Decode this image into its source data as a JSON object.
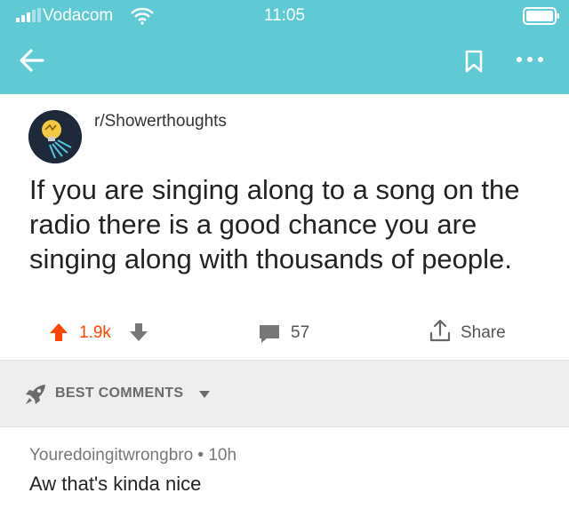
{
  "status_bar": {
    "carrier": "Vodacom",
    "time": "11:05"
  },
  "colors": {
    "header_bg": "#5fc9d4",
    "upvote_accent": "#ff4500",
    "sort_bar_bg": "#eeeeef"
  },
  "icons": {
    "back": "arrow-left-icon",
    "bookmark": "bookmark-icon",
    "more": "more-horizontal-icon",
    "upvote": "arrow-up-icon",
    "downvote": "arrow-down-icon",
    "comments": "comment-bubble-icon",
    "share": "share-icon",
    "sort": "rocket-icon"
  },
  "post": {
    "subreddit": "r/Showerthoughts",
    "title": "If you are singing along to a song on the radio there is a good chance you are singing along with thousands of people.",
    "score": "1.9k",
    "comment_count": "57",
    "share_label": "Share"
  },
  "comments_section": {
    "sort_label": "BEST COMMENTS",
    "first_comment": {
      "meta": "Youredoingitwrongbro • 10h",
      "body": "Aw that's kinda nice"
    }
  }
}
